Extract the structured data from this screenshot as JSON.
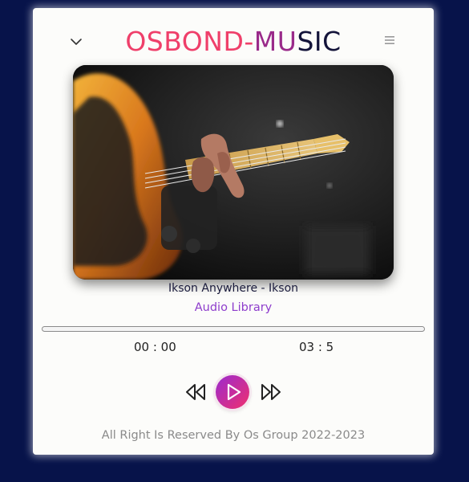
{
  "header": {
    "brand_part1": "OSBOND-",
    "brand_part2": "MU",
    "brand_part3": "SIC",
    "collapse_icon": "chevron-down-icon",
    "menu_icon": "hamburger-menu-icon"
  },
  "player": {
    "cover_image": "bass-guitar-closeup",
    "track_title": "Ikson Anywhere - Ikson",
    "track_source": "Audio Library",
    "current_time": "00 : 00",
    "duration": "03 : 5",
    "progress": 0,
    "controls": {
      "previous_icon": "rewind-icon",
      "play_icon": "play-icon",
      "next_icon": "fast-forward-icon"
    }
  },
  "footer": {
    "text": "All Right Is Reserved By Os Group 2022-2023"
  },
  "colors": {
    "background": "#07134a",
    "accent_pink": "#ef3f6a",
    "accent_purple": "#9a2bd0",
    "brand_dark": "#14143a",
    "subtitle": "#8e3dcc"
  }
}
